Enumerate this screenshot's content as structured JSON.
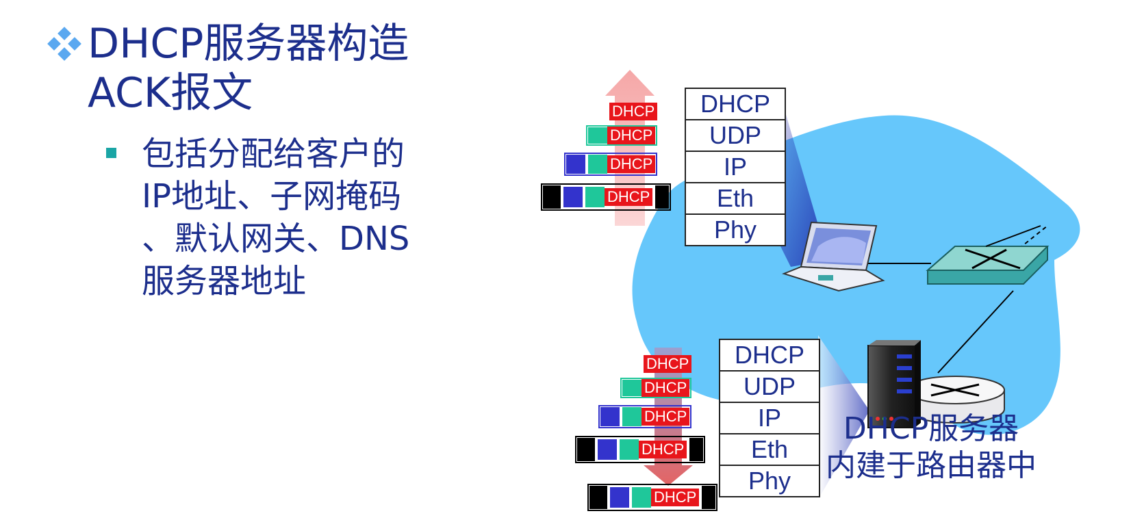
{
  "title": {
    "line1": "DHCP服务器构造",
    "line2": "ACK报文"
  },
  "bullet": {
    "lines": [
      "包括分配给客户的",
      "IP地址、子网掩码",
      "、默认网关、DNS",
      "服务器地址"
    ]
  },
  "client_stack": {
    "layers": [
      "DHCP",
      "UDP",
      "IP",
      "Eth",
      "Phy"
    ]
  },
  "server_stack": {
    "layers": [
      "DHCP",
      "UDP",
      "IP",
      "Eth",
      "Phy"
    ]
  },
  "packet_label": "DHCP",
  "server_caption": {
    "line1": "DHCP服务器",
    "line2": "内建于路由器中"
  },
  "colors": {
    "text": "#1c2e8c",
    "cloud": "#66c7fb",
    "dhcp": "#e8151b",
    "udp": "#1fc79a",
    "ip": "#3333cc",
    "eth": "#000000",
    "up_arrow": "#f7b9b9",
    "down_arrow": "#e06060"
  }
}
